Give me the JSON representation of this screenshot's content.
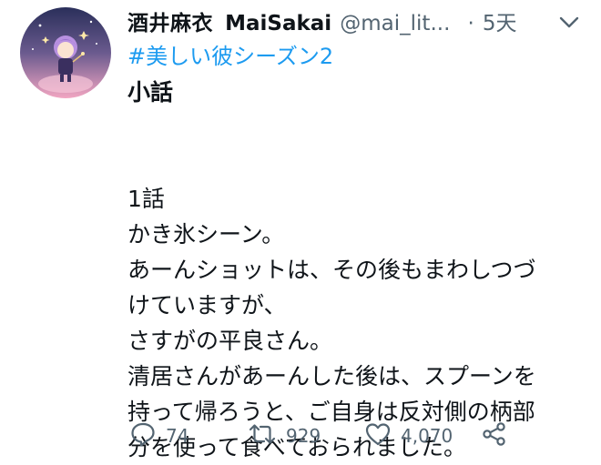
{
  "tweet": {
    "display_name": "酒井麻衣",
    "screen_name": "MaiSakai",
    "handle": "@mai_lit...",
    "separator": "·",
    "time": "5天",
    "hashtag": "#美しい彼シーズン2",
    "title": "小話",
    "lines": [
      "1話",
      "かき氷シーン。",
      "あーんショットは、その後もまわしつづ",
      "けていますが、",
      "さすがの平良さん。",
      "清居さんがあーんした後は、スプーンを",
      "持って帰ろうと、ご自身は反対側の柄部",
      "分を使って食べておられました。"
    ]
  },
  "actions": {
    "reply": {
      "icon": "reply-icon",
      "count": "74"
    },
    "retweet": {
      "icon": "retweet-icon",
      "count": "929"
    },
    "like": {
      "icon": "heart-icon",
      "count": "4,070"
    },
    "share": {
      "icon": "share-icon"
    }
  },
  "colors": {
    "link": "#1d9bf0",
    "secondary_text": "#536471",
    "primary_text": "#0f1419"
  }
}
